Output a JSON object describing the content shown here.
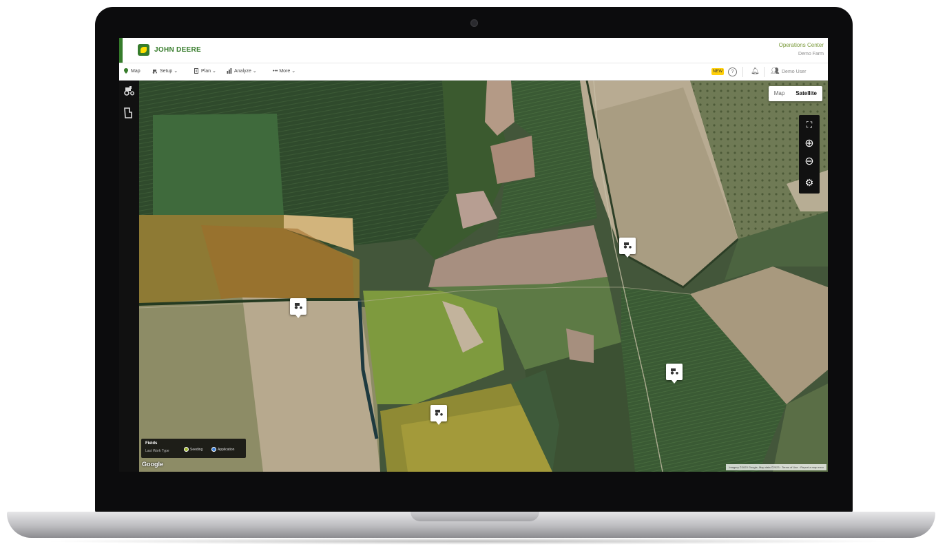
{
  "brand": {
    "name": "JOHN DEERE",
    "app_title": "Operations Center",
    "org_name": "Demo Farm"
  },
  "nav": {
    "items": [
      {
        "label": "Map"
      },
      {
        "label": "Setup"
      },
      {
        "label": "Plan"
      },
      {
        "label": "Analyze"
      },
      {
        "label": "More"
      }
    ],
    "new_badge": "NEW",
    "help": "?",
    "user_name": "Demo User"
  },
  "map": {
    "view_options": [
      "Map",
      "Satellite"
    ],
    "selected_view": "Satellite",
    "legend": {
      "title": "Fields",
      "subtitle": "Last Work Type",
      "items": [
        {
          "label": "Seeding",
          "color": "#a0b830"
        },
        {
          "label": "Application",
          "color": "#3b7fd9"
        }
      ]
    },
    "google_label": "Google",
    "attribution": "Imagery ©2023 Google, Map data ©2023 · Terms of Use · Report a map error"
  },
  "colors": {
    "deere_green": "#367c2b",
    "deere_yellow": "#ffde00"
  }
}
